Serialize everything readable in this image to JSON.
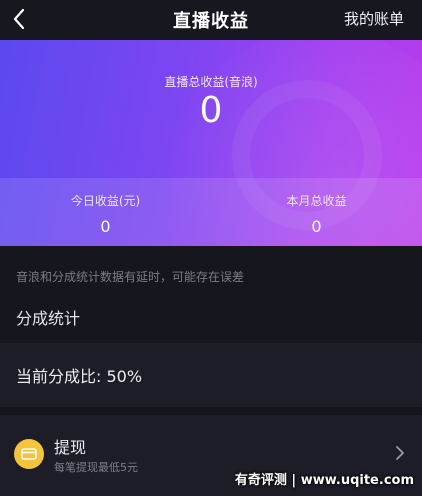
{
  "header": {
    "title": "直播收益",
    "bill_label": "我的账单"
  },
  "card": {
    "total_label": "直播总收益(音浪)",
    "total_value": "0",
    "today_label": "今日收益(元)",
    "today_value": "0",
    "month_label": "本月总收益",
    "month_value": "0"
  },
  "notice": "音浪和分成统计数据有延时，可能存在误差",
  "split": {
    "section_title": "分成统计",
    "ratio_text": "当前分成比: 50%"
  },
  "withdraw": {
    "title": "提现",
    "subtitle": "每笔提现最低5元"
  },
  "watermark": "有奇评测 | www.uqite.com",
  "colors": {
    "gradient_start": "#5b48f0",
    "gradient_end": "#b83cec",
    "coin": "#f4c43a",
    "background": "#16161f"
  }
}
